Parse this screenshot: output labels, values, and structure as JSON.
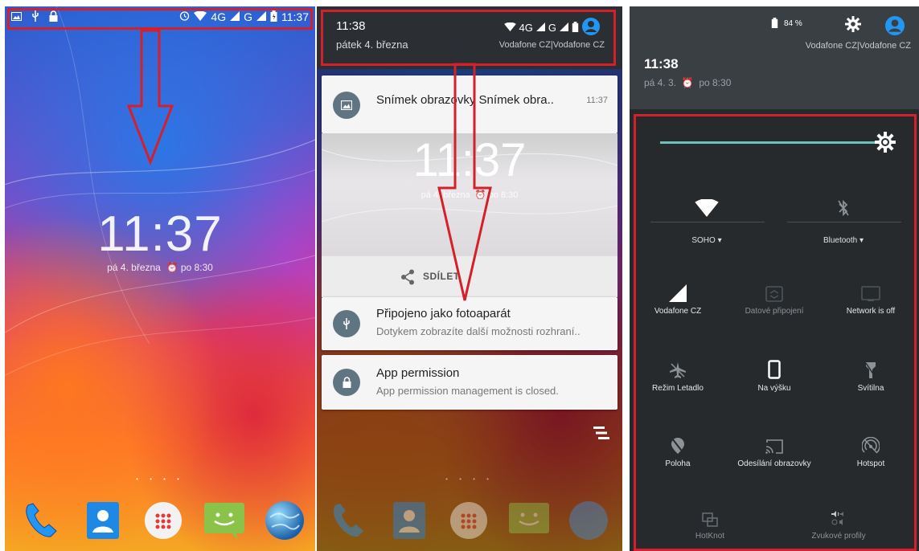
{
  "colors": {
    "highlight_red": "#d4202a",
    "accent_teal": "#6ec1b8",
    "quick_settings_bg": "#262a2d",
    "notification_icon_bg": "#5f7582"
  },
  "lockscreen": {
    "statusbar": {
      "network": "4G",
      "network2": "G",
      "time": "11:37",
      "left_icons": [
        "image-icon",
        "usb-icon",
        "lock-icon"
      ],
      "right_icons": [
        "alarm-icon",
        "wifi-icon",
        "signal-icon",
        "battery-icon"
      ]
    },
    "clock": "11:37",
    "date": "pá 4. března",
    "alarm": "po 8:30",
    "page_dots": "• • • •",
    "dock": [
      "phone-icon",
      "contacts-icon",
      "app-drawer-icon",
      "messaging-icon",
      "browser-icon"
    ]
  },
  "shade": {
    "time": "11:38",
    "date": "pátek 4. března",
    "network": "4G",
    "network2": "G",
    "carrier": "Vodafone CZ|Vodafone CZ",
    "notifications": [
      {
        "title": "Snímek obrazovky Snímek obra..",
        "time": "11:37",
        "icon": "image-icon"
      },
      {
        "title": "Připojeno jako fotoaparát",
        "text": "Dotykem zobrazíte další možnosti rozhraní..",
        "icon": "usb-icon"
      },
      {
        "title": "App permission",
        "text": "App permission management is closed.",
        "icon": "lock-icon"
      }
    ],
    "screenshot_preview": {
      "clock": "11:37",
      "date": "pá 4. března",
      "alarm": "po 8:30"
    },
    "share_label": "SDÍLET"
  },
  "quick_settings": {
    "battery": "84 %",
    "time": "11:38",
    "date": "pá 4. 3.",
    "alarm": "po 8:30",
    "carrier": "Vodafone CZ|Vodafone CZ",
    "brightness": 0.96,
    "wifi_label": "SOHO",
    "bluetooth_label": "Bluetooth",
    "tiles": [
      {
        "label": "Vodafone CZ",
        "icon": "cell-signal-icon",
        "active": true
      },
      {
        "label": "Datové připojení",
        "icon": "mobile-data-icon",
        "active": false
      },
      {
        "label": "Network is off",
        "icon": "network-off-icon",
        "active": false
      },
      {
        "label": "Režim Letadlo",
        "icon": "airplane-icon",
        "active": false
      },
      {
        "label": "Na výšku",
        "icon": "portrait-icon",
        "active": true
      },
      {
        "label": "Svítilna",
        "icon": "flashlight-icon",
        "active": false
      },
      {
        "label": "Poloha",
        "icon": "location-off-icon",
        "active": false
      },
      {
        "label": "Odesílání obrazovky",
        "icon": "cast-icon",
        "active": false
      },
      {
        "label": "Hotspot",
        "icon": "hotspot-icon",
        "active": false
      },
      {
        "label": "HotKnot",
        "icon": "hotknot-icon",
        "active": false
      },
      {
        "label": "Zvukové profily",
        "icon": "sound-profile-icon",
        "active": false
      }
    ]
  }
}
